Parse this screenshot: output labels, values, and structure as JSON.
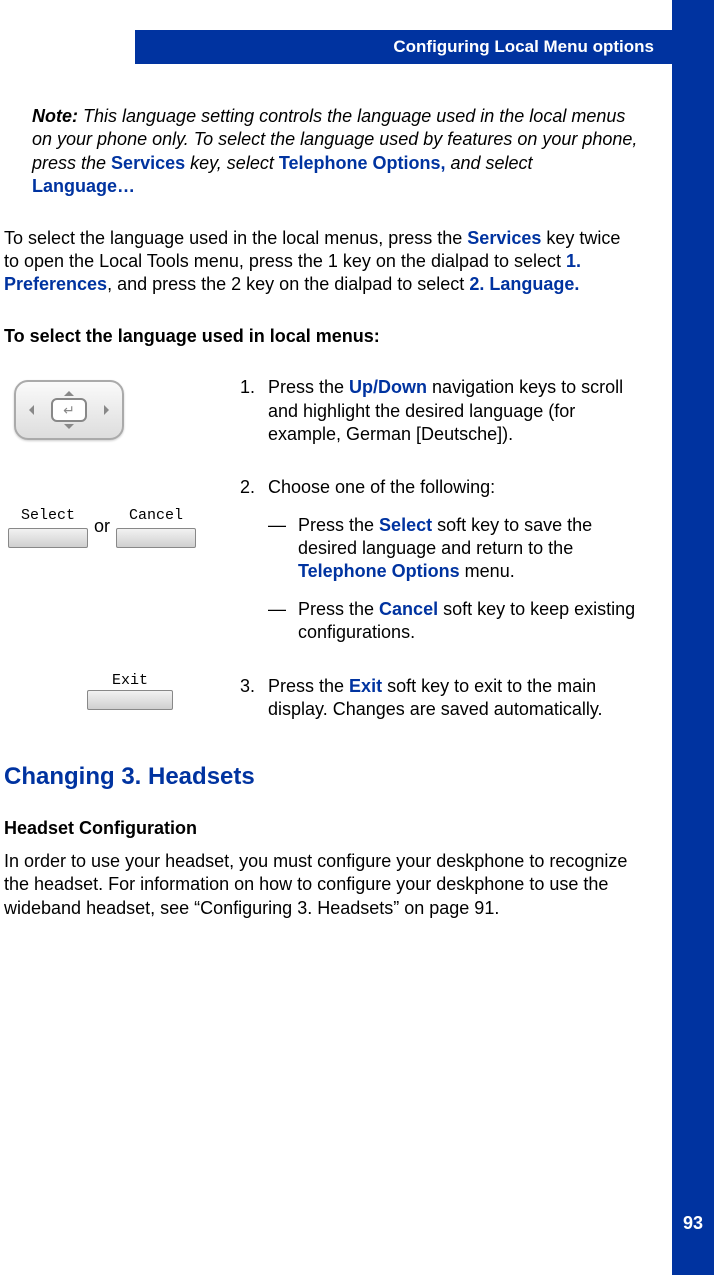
{
  "header": {
    "title": "Configuring Local Menu options"
  },
  "page_number": "93",
  "note": {
    "head": "Note:",
    "body_a": " This language setting controls the language used in the local menus on your phone only. To select the language used by features on your phone, press the ",
    "services": "Services",
    "body_b": " key, select ",
    "telopt": "Telephone Options,",
    "body_c": " and select ",
    "lang": "Language…"
  },
  "intro": {
    "a": "To select the language used in the local menus, press the ",
    "services": "Services",
    "b": " key twice to open the Local Tools menu, press the 1 key on the dialpad to select ",
    "prefs": "1. Preferences",
    "c": ", and press the 2 key on the dialpad to select ",
    "langopt": "2. Language."
  },
  "subhead": "To select the language used in local menus:",
  "softkeys": {
    "select": "Select",
    "cancel": "Cancel",
    "exit": "Exit",
    "or": "or"
  },
  "steps": {
    "s1": {
      "num": "1.",
      "a": "Press the ",
      "updown": "Up/Down",
      "b": " navigation keys to scroll and highlight the desired language (for example, German [Deutsche])."
    },
    "s2": {
      "num": "2.",
      "lead": "Choose one of the following:",
      "opt1a": "Press the ",
      "opt1sel": "Select",
      "opt1b": " soft key to save the desired language and return to the ",
      "opt1tel": "Telephone Options",
      "opt1c": " menu.",
      "opt2a": "Press the ",
      "opt2can": "Cancel",
      "opt2b": " soft key to keep existing configurations."
    },
    "s3": {
      "num": "3.",
      "a": "Press the ",
      "exit": "Exit",
      "b": " soft key to exit to the main display. Changes are saved automatically."
    }
  },
  "section": {
    "head": "Changing 3. Headsets",
    "sub": "Headset Configuration",
    "body": "In order to use your headset, you must configure your deskphone to recognize the headset. For information on how to configure your deskphone to use the wideband headset, see “Configuring 3. Headsets” on page 91."
  }
}
